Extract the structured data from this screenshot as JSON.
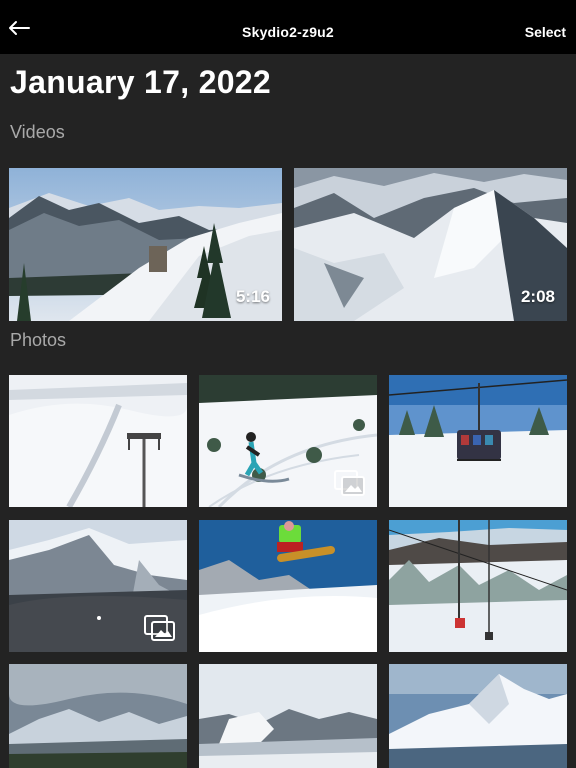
{
  "header": {
    "back_icon": "arrow-left-icon",
    "title": "Skydio2-z9u2",
    "select_label": "Select"
  },
  "date_heading": "January 17, 2022",
  "sections": {
    "videos_label": "Videos",
    "photos_label": "Photos"
  },
  "videos": [
    {
      "duration": "5:16"
    },
    {
      "duration": "2:08"
    }
  ],
  "photos": [
    {
      "burst": false
    },
    {
      "burst": true
    },
    {
      "burst": false
    },
    {
      "burst": true
    },
    {
      "burst": false
    },
    {
      "burst": false
    },
    {
      "burst": false
    },
    {
      "burst": false
    },
    {
      "burst": false
    }
  ],
  "burst_icon": "image-stack-icon",
  "colors": {
    "topbar": "#000000",
    "background": "#232323",
    "section_label": "#a9a9a9"
  }
}
